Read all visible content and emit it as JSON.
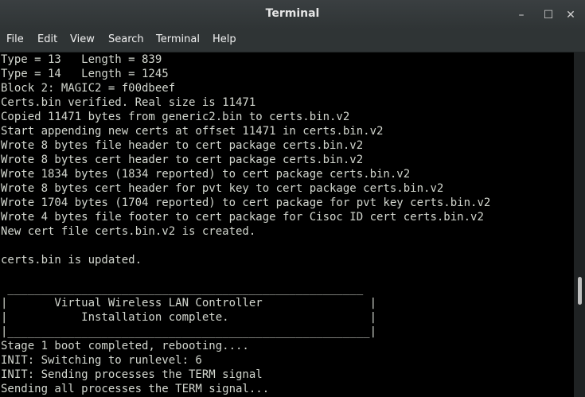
{
  "window": {
    "title": "Terminal",
    "minimize_glyph": "–",
    "maximize_glyph": "☐",
    "close_glyph": "✕"
  },
  "menu": [
    "File",
    "Edit",
    "View",
    "Search",
    "Terminal",
    "Help"
  ],
  "terminal_lines": [
    "Type = 13   Length = 839",
    "Type = 14   Length = 1245",
    "Block 2: MAGIC2 = f00dbeef",
    "Certs.bin verified. Real size is 11471",
    "Copied 11471 bytes from generic2.bin to certs.bin.v2",
    "Start appending new certs at offset 11471 in certs.bin.v2",
    "Wrote 8 bytes file header to cert package certs.bin.v2",
    "Wrote 8 bytes cert header to cert package certs.bin.v2",
    "Wrote 1834 bytes (1834 reported) to cert package certs.bin.v2",
    "Wrote 8 bytes cert header for pvt key to cert package certs.bin.v2",
    "Wrote 1704 bytes (1704 reported) to cert package for pvt key certs.bin.v2",
    "Wrote 4 bytes file footer to cert package for Cisoc ID cert certs.bin.v2",
    "New cert file certs.bin.v2 is created.",
    "",
    "certs.bin is updated.",
    "",
    " _____________________________________________________",
    "|       Virtual Wireless LAN Controller                |",
    "|           Installation complete.                     |",
    "|______________________________________________________|",
    "Stage 1 boot completed, rebooting....",
    "INIT: Switching to runlevel: 6",
    "INIT: Sending processes the TERM signal",
    "Sending all processes the TERM signal..."
  ]
}
